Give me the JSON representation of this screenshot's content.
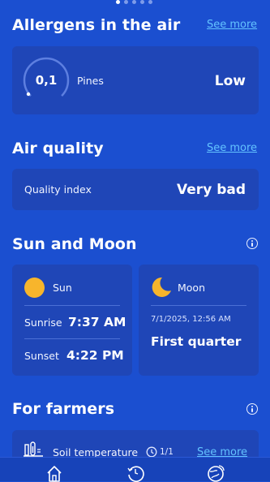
{
  "pager": {
    "count": 5,
    "active": 0
  },
  "allergens": {
    "title": "Allergens in the air",
    "see_more": "See more",
    "value": "0,1",
    "label": "Pines",
    "level": "Low"
  },
  "air_quality": {
    "title": "Air quality",
    "see_more": "See more",
    "label": "Quality index",
    "value": "Very bad"
  },
  "sun_moon": {
    "title": "Sun and Moon",
    "sun": {
      "label": "Sun",
      "sunrise_label": "Sunrise",
      "sunrise_time": "7:37 AM",
      "sunset_label": "Sunset",
      "sunset_time": "4:22 PM"
    },
    "moon": {
      "label": "Moon",
      "datetime": "7/1/2025, 12:56 AM",
      "phase": "First quarter"
    }
  },
  "farmers": {
    "title": "For farmers",
    "item_label": "Soil temperature",
    "count": "1/1",
    "see_more": "See more"
  },
  "colors": {
    "background": "#1b4fd0",
    "card": "#1f46b7",
    "link": "#63c3ff",
    "sun": "#f7b52c",
    "moon": "#f7b52c"
  },
  "bottom_nav": {
    "icons": [
      "home-icon",
      "history-24h-icon",
      "globe-radar-icon"
    ]
  }
}
